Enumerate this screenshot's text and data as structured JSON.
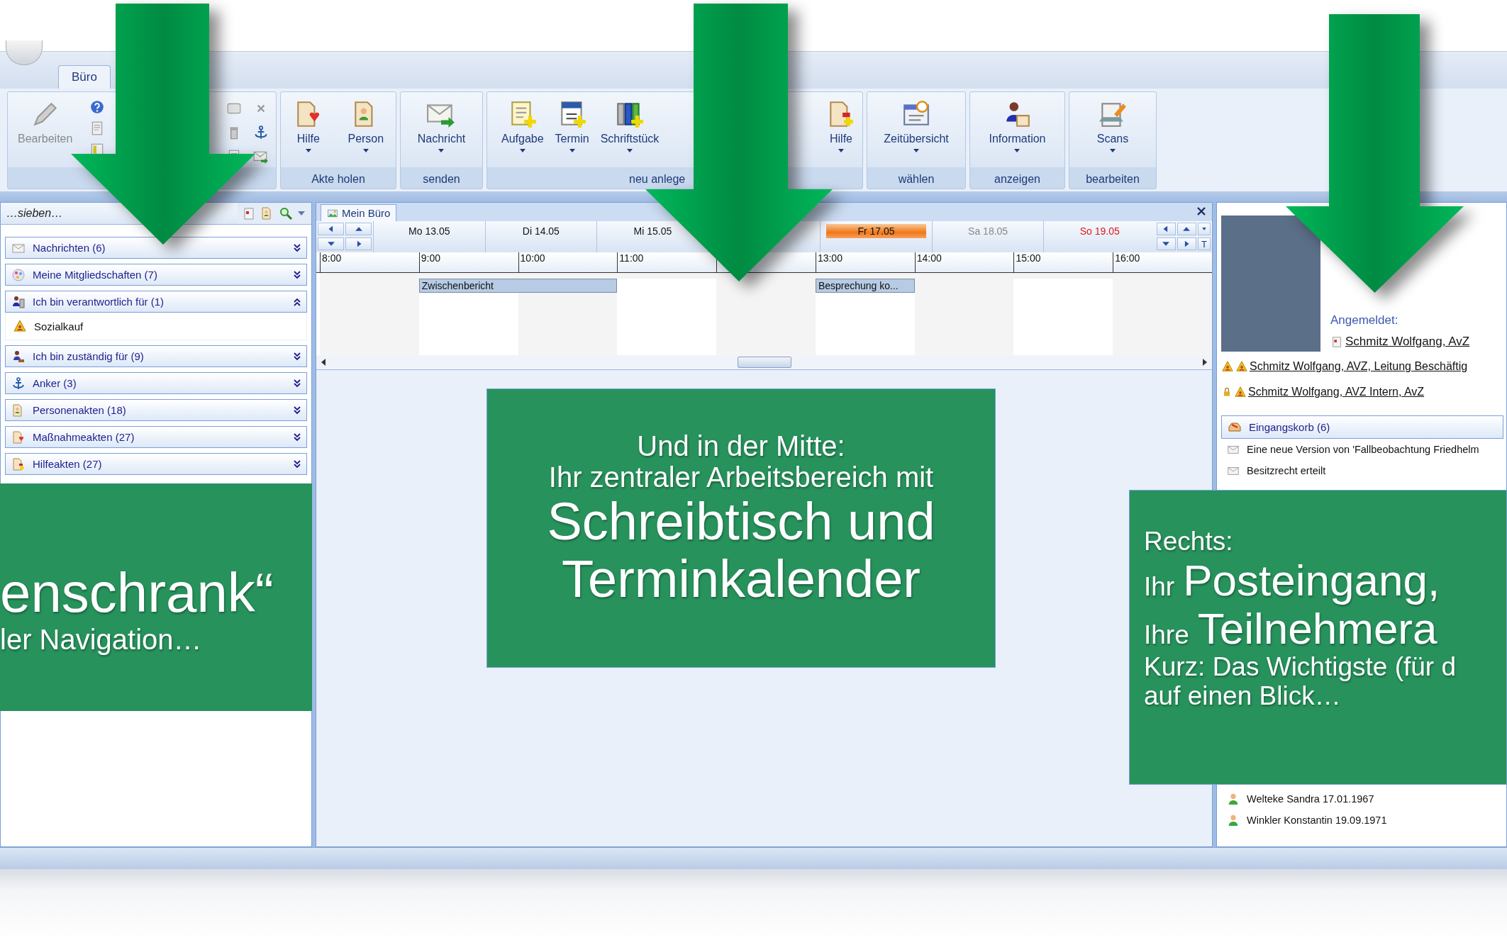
{
  "app_tab": {
    "label": "Büro",
    "selected": true
  },
  "ribbon": {
    "groups": [
      {
        "buttons": [
          {
            "label": "Bearbeiten",
            "dropdown": false,
            "disabled": true
          }
        ]
      },
      {
        "label": "Akte holen",
        "buttons": [
          {
            "label": "Hilfe",
            "dropdown": true,
            "disabled": false
          },
          {
            "label": "Person",
            "dropdown": true,
            "disabled": false
          }
        ]
      },
      {
        "label": "senden",
        "buttons": [
          {
            "label": "Nachricht",
            "dropdown": true,
            "disabled": false
          }
        ]
      },
      {
        "label": "neu anlege",
        "buttons": [
          {
            "label": "Aufgabe",
            "dropdown": true,
            "disabled": false
          },
          {
            "label": "Termin",
            "dropdown": true,
            "disabled": false
          },
          {
            "label": "Schriftstück",
            "dropdown": true,
            "disabled": false
          },
          {
            "label": "Hilfe",
            "dropdown": true,
            "disabled": false
          }
        ]
      },
      {
        "label": "wählen",
        "buttons": [
          {
            "label": "Zeitübersicht",
            "dropdown": true,
            "disabled": false
          }
        ]
      },
      {
        "label": "anzeigen",
        "buttons": [
          {
            "label": "Information",
            "dropdown": true,
            "disabled": false
          }
        ]
      },
      {
        "label": "bearbeiten",
        "buttons": [
          {
            "label": "Scans",
            "dropdown": true,
            "disabled": false
          }
        ]
      }
    ]
  },
  "navigator": {
    "search": {
      "value": "…sieben…"
    },
    "groups": [
      {
        "label": "Nachrichten (6)",
        "expanded": false
      },
      {
        "label": "Meine Mitgliedschaften (7)",
        "expanded": false
      },
      {
        "label": "Ich bin verantwortlich für (1)",
        "expanded": true,
        "children": [
          {
            "label": "Sozialkauf"
          }
        ]
      },
      {
        "label": "Ich bin zuständig für (9)",
        "expanded": false
      },
      {
        "label": "Anker (3)",
        "expanded": false
      },
      {
        "label": "Personenakten (18)",
        "expanded": false
      },
      {
        "label": "Maßnahmeakten (27)",
        "expanded": false
      },
      {
        "label": "Hilfeakten (27)",
        "expanded": false
      }
    ]
  },
  "desk": {
    "tab": {
      "label": "Mein Büro",
      "selected": true
    },
    "today_label": "T",
    "days": [
      {
        "label": "Mo 13.05",
        "kind": "weekday",
        "selected": false
      },
      {
        "label": "Di 14.05",
        "kind": "weekday",
        "selected": false
      },
      {
        "label": "Mi 15.05",
        "kind": "weekday",
        "selected": false
      },
      {
        "kind": "weekday",
        "selected": false
      },
      {
        "label": "Fr 17.05",
        "kind": "weekday",
        "selected": true
      },
      {
        "label": "Sa 18.05",
        "kind": "saturday",
        "selected": false
      },
      {
        "label": "So 19.05",
        "kind": "sunday",
        "selected": false
      }
    ],
    "hours": [
      "8:00",
      "9:00",
      "10:00",
      "11:00",
      "13:00",
      "14:00",
      "15:00",
      "16:00"
    ],
    "events": [
      {
        "label": "Zwischenbericht"
      },
      {
        "label": "Besprechung ko..."
      }
    ]
  },
  "profile": {
    "signed_in_label": "Angemeldet:",
    "user": "Schmitz Wolfgang, AvZ",
    "roles": [
      {
        "label": "Schmitz Wolfgang, AVZ, Leitung Beschäftig",
        "kind": "shared"
      },
      {
        "label": "Schmitz Wolfgang, AVZ Intern, AvZ",
        "kind": "locked"
      }
    ]
  },
  "inbox": {
    "title": "Eingangskorb (6)",
    "items": [
      {
        "label": "Eine neue Version von 'Fallbeobachtung Friedhelm"
      },
      {
        "label": "Besitzrecht erteilt"
      }
    ]
  },
  "people": [
    {
      "label": "Welteke Sandra 17.01.1967"
    },
    {
      "label": "Winkler Konstantin 19.09.1971"
    }
  ],
  "callouts": [
    {
      "kind": "left",
      "lines": [
        [
          "enschrank“"
        ],
        [
          "ler Navigation…"
        ]
      ]
    },
    {
      "kind": "center",
      "lines": [
        [
          "Und in der Mitte:"
        ],
        [
          "Ihr zentraler Arbeitsbereich mit"
        ],
        [
          "Schreibtisch und"
        ],
        [
          "Terminkalender"
        ]
      ]
    },
    {
      "kind": "right",
      "lines": [
        [
          "Rechts:"
        ],
        [
          "Ihr",
          "Posteingang,"
        ],
        [
          "Ihre",
          "Teilnehmera"
        ],
        [
          "Kurz: Das Wichtigste (für d"
        ],
        [
          "auf einen Blick…"
        ]
      ]
    }
  ]
}
